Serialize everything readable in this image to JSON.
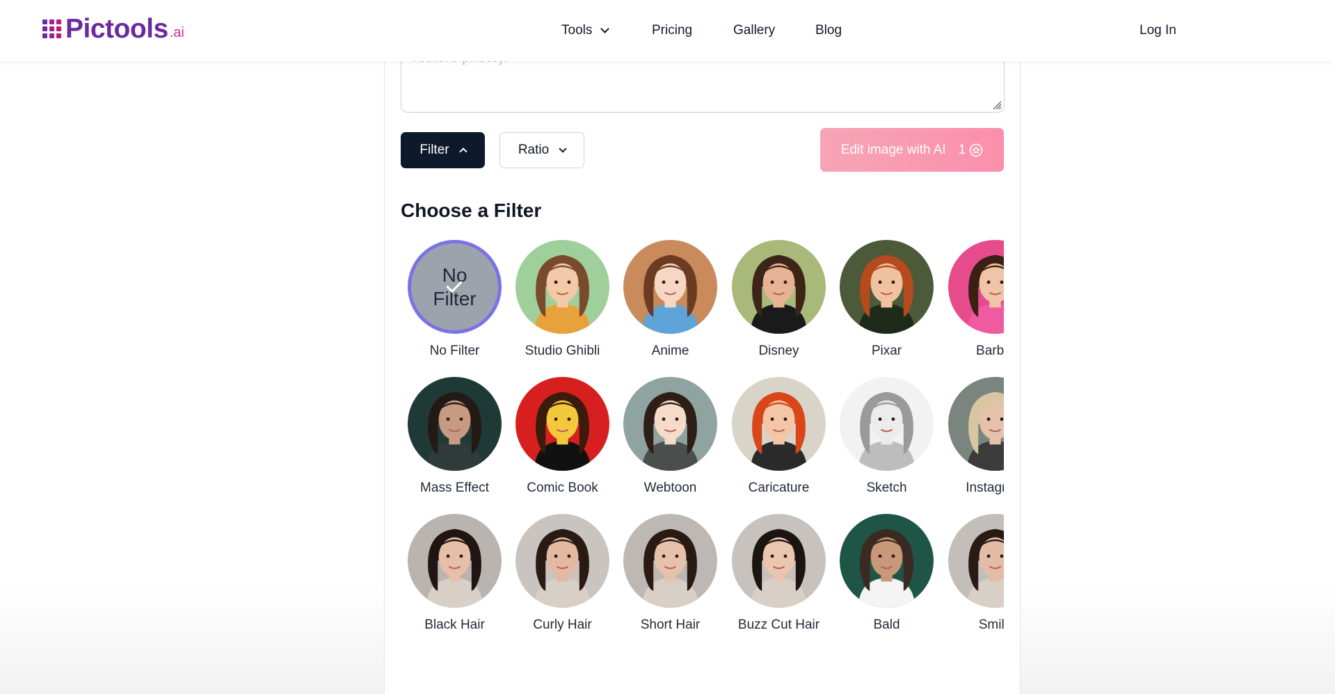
{
  "header": {
    "logo_text": "Pictools",
    "logo_suffix": ".ai",
    "nav": [
      {
        "label": "Tools",
        "has_dropdown": true
      },
      {
        "label": "Pricing"
      },
      {
        "label": "Gallery"
      },
      {
        "label": "Blog"
      }
    ],
    "login_label": "Log In"
  },
  "editor": {
    "prompt_text": "restore photo).",
    "filter_label": "Filter",
    "ratio_label": "Ratio",
    "edit_label": "Edit image with AI",
    "credit_count": "1",
    "filters_heading": "Choose a Filter"
  },
  "filters": [
    {
      "label": "No Filter",
      "selected": true,
      "badge": "No Filter",
      "bg": "#9ca3ad"
    },
    {
      "label": "Studio Ghibli",
      "bg": "#9fcf9a",
      "hair": "#7a4a2c",
      "skin": "#f3c9a8",
      "accent": "#e8a23b"
    },
    {
      "label": "Anime",
      "bg": "#c98a5c",
      "hair": "#6b3b22",
      "skin": "#f6d7c3",
      "accent": "#5ea4d8"
    },
    {
      "label": "Disney",
      "bg": "#a9b97a",
      "hair": "#3d2418",
      "skin": "#e7b394",
      "accent": "#1a1a1a"
    },
    {
      "label": "Pixar",
      "bg": "#4c5a3a",
      "hair": "#b44a1e",
      "skin": "#f1c2a0",
      "accent": "#1f2b1a"
    },
    {
      "label": "Barbie",
      "bg": "#e64c8c",
      "hair": "#3a1f14",
      "skin": "#f0c4a6",
      "accent": "#f05aa0"
    },
    {
      "label": "Mass Effect",
      "bg": "#1f3a36",
      "hair": "#231a16",
      "skin": "#c79a82",
      "accent": "#2f3a3a"
    },
    {
      "label": "Comic Book",
      "bg": "#d81f1f",
      "hair": "#3b1c0c",
      "skin": "#f3c83a",
      "accent": "#111111"
    },
    {
      "label": "Webtoon",
      "bg": "#8fa3a0",
      "hair": "#2d1e16",
      "skin": "#f4dcc9",
      "accent": "#4a4f4d"
    },
    {
      "label": "Caricature",
      "bg": "#d9d4c8",
      "hair": "#d9461a",
      "skin": "#f3c7a6",
      "accent": "#2a2a2a"
    },
    {
      "label": "Sketch",
      "bg": "#f2f2f2",
      "hair": "#9a9a9a",
      "skin": "#ececec",
      "accent": "#bdbdbd"
    },
    {
      "label": "Instagram",
      "bg": "#7a8580",
      "hair": "#d8c6a0",
      "skin": "#e6c2ac",
      "accent": "#3b3b3b"
    },
    {
      "label": "Black Hair",
      "bg": "#b9b4af",
      "hair": "#1f1512",
      "skin": "#e5bfa8",
      "accent": "#d8cfc6"
    },
    {
      "label": "Curly Hair",
      "bg": "#c9c4bf",
      "hair": "#2a1a14",
      "skin": "#e3b9a1",
      "accent": "#d8cfc6"
    },
    {
      "label": "Short Hair",
      "bg": "#bdb8b3",
      "hair": "#2a1a14",
      "skin": "#e7c2ab",
      "accent": "#d8cfc6"
    },
    {
      "label": "Buzz Cut Hair",
      "bg": "#c7c2bd",
      "hair": "#1c1411",
      "skin": "#eac6b0",
      "accent": "#d8cfc6"
    },
    {
      "label": "Bald",
      "bg": "#1e5546",
      "hair": "#3a2a22",
      "skin": "#c99878",
      "accent": "#f4f4f4"
    },
    {
      "label": "Smile",
      "bg": "#c3beb9",
      "hair": "#2a1a14",
      "skin": "#e3bca5",
      "accent": "#d8cfc6"
    }
  ]
}
